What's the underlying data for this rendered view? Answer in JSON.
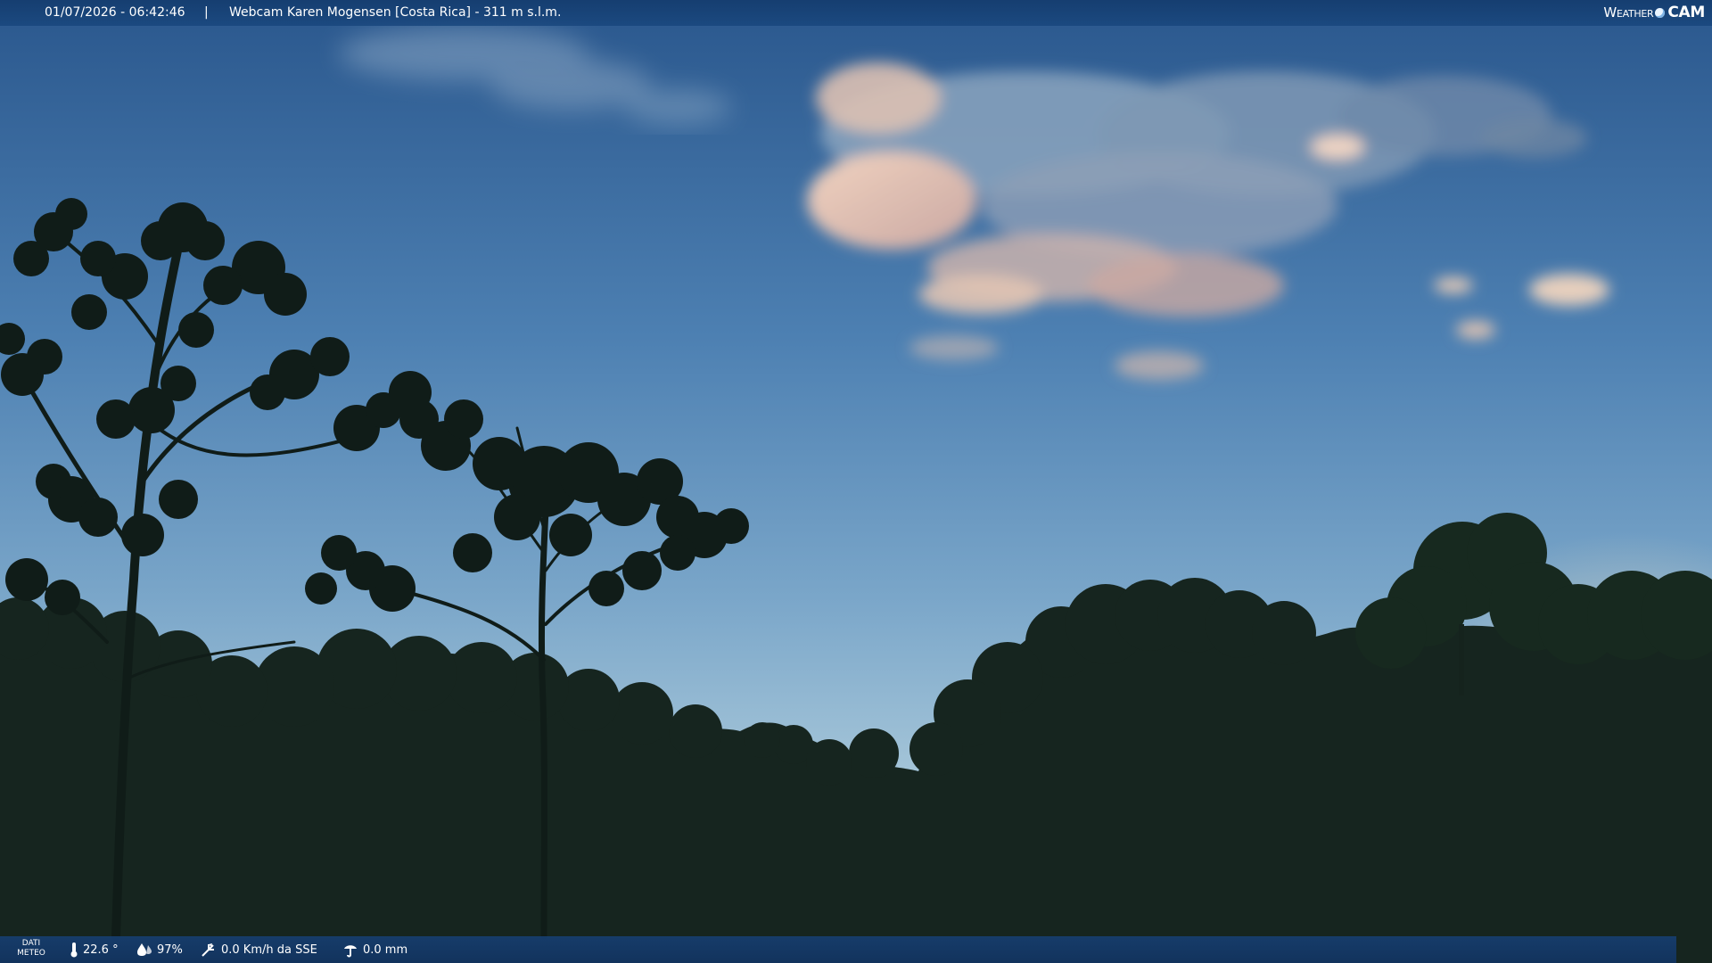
{
  "overlay": {
    "timestamp": "01/07/2026 - 06:42:46",
    "separator": "|",
    "camera_label": "Webcam Karen Mogensen [Costa Rica]  - 311 m s.l.m.",
    "logo": {
      "word": "Weather",
      "mark": "CAM"
    }
  },
  "meteo": {
    "label_line1": "DATI",
    "label_line2": "METEO",
    "temperature": "22.6 °",
    "humidity": "97%",
    "wind": "0.0 Km/h da SSE",
    "rain": "0.0 mm"
  },
  "colors": {
    "sky_top": "#2b5a8f",
    "sky_mid": "#5e8fbc",
    "sky_horizon": "#a6c8dc",
    "bar_blue": "#1a4a86",
    "cloud_pink": "#e8c6b4",
    "forest": "#17271f"
  },
  "icons": [
    "thermometer-icon",
    "humidity-icon",
    "wind-icon",
    "rain-gauge-icon",
    "weathercam-logo"
  ]
}
